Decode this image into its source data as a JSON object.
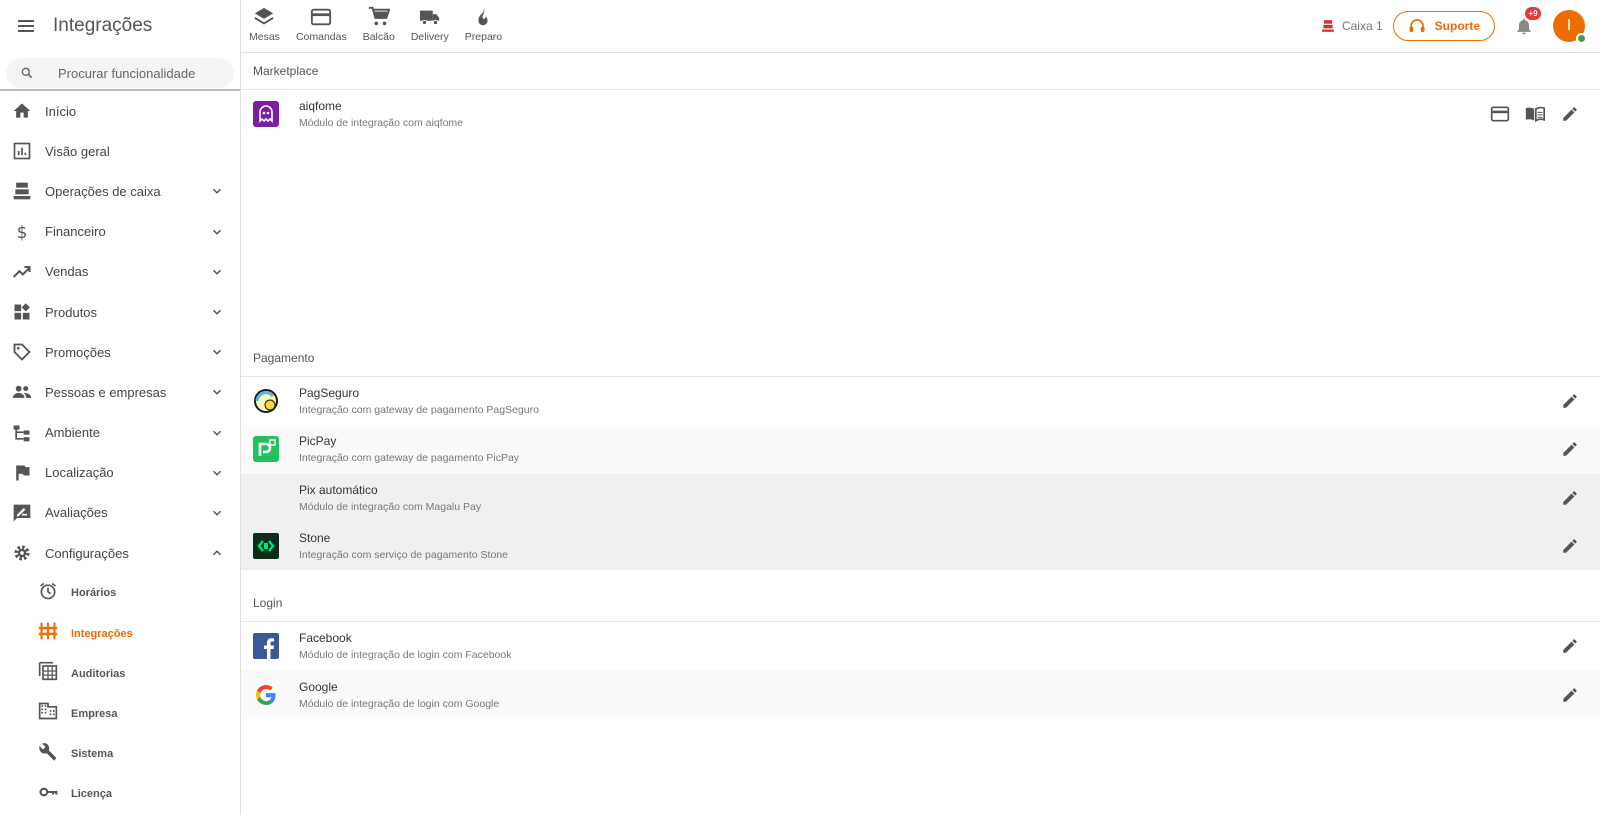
{
  "app": {
    "title": "Integrações",
    "search_placeholder": "Procurar funcionalidade",
    "accent_color": "#ef6c00"
  },
  "sidebar": {
    "items": [
      {
        "label": "Início",
        "icon": "home-icon"
      },
      {
        "label": "Visão geral",
        "icon": "chart-icon"
      },
      {
        "label": "Operações de caixa",
        "icon": "cash-register-icon"
      },
      {
        "label": "Financeiro",
        "icon": "dollar-icon"
      },
      {
        "label": "Vendas",
        "icon": "trending-up-icon"
      },
      {
        "label": "Produtos",
        "icon": "widgets-icon"
      },
      {
        "label": "Promoções",
        "icon": "tag-icon"
      },
      {
        "label": "Pessoas e empresas",
        "icon": "people-icon"
      },
      {
        "label": "Ambiente",
        "icon": "structure-icon"
      },
      {
        "label": "Localização",
        "icon": "flag-icon"
      },
      {
        "label": "Avaliações",
        "icon": "rate-review-icon"
      },
      {
        "label": "Configurações",
        "icon": "gear-icon"
      }
    ],
    "sub_items": [
      {
        "label": "Horários",
        "icon": "alarm-icon"
      },
      {
        "label": "Integrações",
        "icon": "integrations-icon",
        "active": true
      },
      {
        "label": "Auditorias",
        "icon": "audit-icon"
      },
      {
        "label": "Empresa",
        "icon": "building-icon"
      },
      {
        "label": "Sistema",
        "icon": "wrench-icon"
      },
      {
        "label": "Licença",
        "icon": "key-icon"
      }
    ]
  },
  "topbar": {
    "quick_actions": [
      {
        "label": "Mesas",
        "icon": "layers-icon"
      },
      {
        "label": "Comandas",
        "icon": "card-icon"
      },
      {
        "label": "Balcão",
        "icon": "cart-icon"
      },
      {
        "label": "Delivery",
        "icon": "truck-icon"
      },
      {
        "label": "Preparo",
        "icon": "fire-icon"
      }
    ],
    "caixa_label": "Caixa 1",
    "suporte_label": "Suporte",
    "notification_badge": "+9",
    "avatar_initial": "I"
  },
  "sections": {
    "marketplace": {
      "title": "Marketplace",
      "items": [
        {
          "name": "aiqfome",
          "description": "Módulo de integração com aiqfome"
        }
      ]
    },
    "pagamento": {
      "title": "Pagamento",
      "items": [
        {
          "name": "PagSeguro",
          "description": "Integração com gateway de pagamento PagSeguro"
        },
        {
          "name": "PicPay",
          "description": "Integração com gateway de pagamento PicPay"
        },
        {
          "name": "Pix automático",
          "description": "Módulo de integração com Magalu Pay"
        },
        {
          "name": "Stone",
          "description": "Integração com serviço de pagamento Stone"
        }
      ]
    },
    "login": {
      "title": "Login",
      "items": [
        {
          "name": "Facebook",
          "description": "Módulo de integração de login com Facebook"
        },
        {
          "name": "Google",
          "description": "Módulo de integração de login com Google"
        }
      ]
    }
  }
}
